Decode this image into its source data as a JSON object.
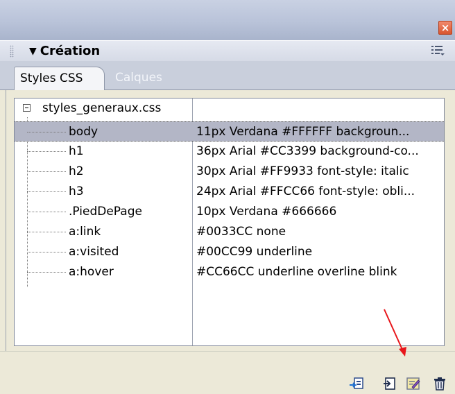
{
  "panel": {
    "title": "Création",
    "close_glyph": "×",
    "options_icon": "panel-options-icon"
  },
  "tabs": [
    {
      "label": "Styles CSS",
      "active": true
    },
    {
      "label": "Calques",
      "active": false
    }
  ],
  "stylesheet": {
    "file_name": "styles_generaux.css",
    "rules": [
      {
        "selector": "body",
        "value": "11px Verdana #FFFFFF backgroun...",
        "selected": true
      },
      {
        "selector": "h1",
        "value": "36px Arial #CC3399 background-co..."
      },
      {
        "selector": "h2",
        "value": "30px Arial #FF9933 font-style: italic"
      },
      {
        "selector": "h3",
        "value": "24px Arial #FFCC66 font-style: obli..."
      },
      {
        "selector": ".PiedDePage",
        "value": "10px Verdana #666666"
      },
      {
        "selector": "a:link",
        "value": "#0033CC none"
      },
      {
        "selector": "a:visited",
        "value": "#00CC99 underline"
      },
      {
        "selector": "a:hover",
        "value": "#CC66CC underline overline blink"
      }
    ]
  },
  "footer_icons": [
    "attach-style-sheet-icon",
    "new-css-style-icon",
    "edit-style-sheet-icon",
    "delete-css-style-icon"
  ],
  "colors": {
    "accent_arrow": "#E8161B",
    "selection": "#B3B6C6"
  }
}
